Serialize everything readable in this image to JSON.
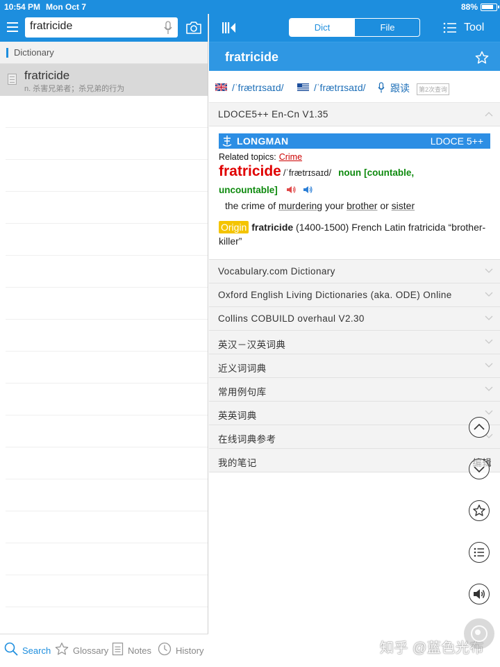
{
  "status_bar": {
    "time": "10:54 PM",
    "date": "Mon Oct 7",
    "battery": "88%"
  },
  "left": {
    "search": {
      "value": "fratricide",
      "placeholder": ""
    },
    "section_title": "Dictionary",
    "results": [
      {
        "word": "fratricide",
        "definition": "n. 杀害兄弟者；杀兄弟的行为"
      }
    ],
    "tabs": [
      {
        "label": "Search",
        "icon": "search-icon",
        "active": true
      },
      {
        "label": "Glossary",
        "icon": "star-icon",
        "active": false
      },
      {
        "label": "Notes",
        "icon": "notes-icon",
        "active": false
      },
      {
        "label": "History",
        "icon": "clock-icon",
        "active": false
      }
    ]
  },
  "right": {
    "segments": {
      "dict": "Dict",
      "file": "File"
    },
    "tool_label": "Tool",
    "headword": "fratricide",
    "pron_uk": "/ˈfrætrɪsaɪd/",
    "pron_us": "/ˈfrætrɪsaɪd/",
    "read_along": "跟读",
    "query_count": "第2次查询",
    "dictionaries": [
      "LDOCE5++ En-Cn V1.35",
      "Vocabulary.com Dictionary",
      "Oxford English Living Dictionaries (aka. ODE) Online",
      "Collins COBUILD overhaul V2.30",
      "英汉－汉英词典",
      "近义词词典",
      "常用例句库",
      "英英词典",
      "在线词典参考",
      "我的笔记"
    ],
    "notes_edit": "编辑",
    "ldoce": {
      "brand": "LONGMAN",
      "edition": "LDOCE 5++",
      "related_label": "Related topics:",
      "related_topic": "Crime",
      "headword": "fratricide",
      "pron": "/ˈfrætrɪsaɪd/",
      "pos": "noun",
      "grammar_1": "[countable,",
      "grammar_2": "uncountable]",
      "def_1": "the crime of ",
      "def_xref_1": "murdering",
      "def_2": " your ",
      "def_xref_2": "brother",
      "def_3": " or ",
      "def_xref_3": "sister",
      "origin_tag": "Origin",
      "origin_word": "fratricide",
      "origin_text": " (1400-1500) French Latin fratricida “brother-killer”"
    }
  },
  "watermark": "知乎 @蓝色光布",
  "colors": {
    "accent": "#1d8ede",
    "headword_red": "#e00000",
    "grammar_green": "#0e8a0e",
    "origin_yellow": "#f4c400"
  }
}
